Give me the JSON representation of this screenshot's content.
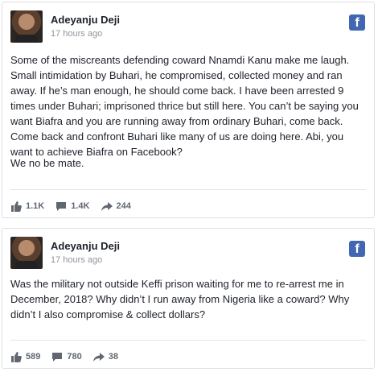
{
  "posts": [
    {
      "author": "Adeyanju Deji",
      "time": "17 hours ago",
      "paragraphs": [
        "Some of the miscreants defending coward Nnamdi Kanu make me laugh. Small intimidation by Buhari, he compromised, collected money and ran away. If he’s man enough, he should come back. I have been arrested 9 times under Buhari; imprisoned thrice but still here. You can’t be saying you want Biafra and you are running away from ordinary Buhari, come back. Come back and confront Buhari like many of us are doing here. Abi, you want to achieve Biafra on Facebook?",
        "We no be mate."
      ],
      "likes": "1.1K",
      "comments": "1.4K",
      "shares": "244"
    },
    {
      "author": "Adeyanju Deji",
      "time": "17 hours ago",
      "paragraphs": [
        "Was the military not outside Keffi prison waiting for me to re-arrest me in December, 2018? Why didn’t I run away from Nigeria like a coward? Why didn’t I also compromise & collect dollars?"
      ],
      "likes": "589",
      "comments": "780",
      "shares": "38"
    }
  ],
  "icons": {
    "brand": "facebook-icon",
    "like": "thumbs-up-icon",
    "comment": "comment-icon",
    "share": "share-arrow-icon"
  },
  "colors": {
    "brand": "#4267b2",
    "meta": "#90949c",
    "action": "#616770"
  }
}
